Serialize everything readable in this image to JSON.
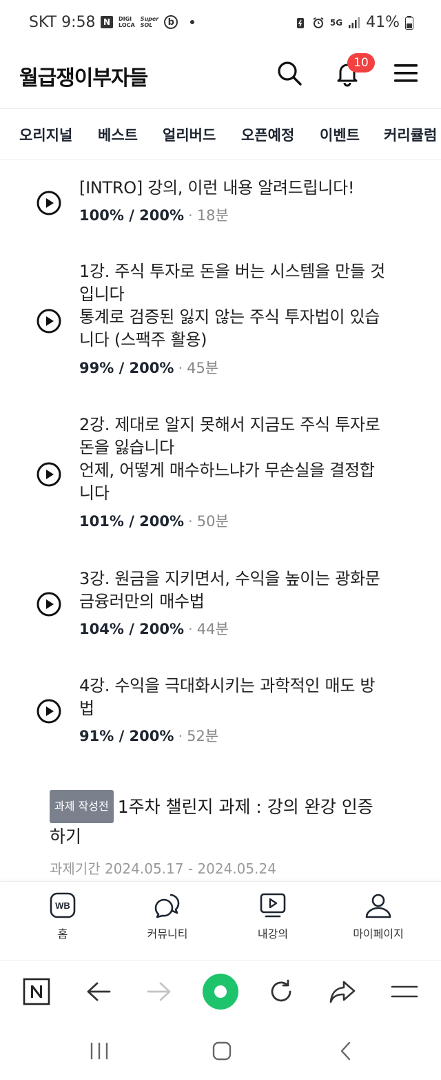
{
  "status_bar": {
    "carrier_time": "SKT 9:58",
    "badge_n": "N",
    "badge_digi": "DIGI",
    "badge_loca": "LOCA",
    "badge_super": "Super",
    "badge_sol": "SOL",
    "badge_b": "b",
    "network": "5G",
    "battery": "41%"
  },
  "header": {
    "logo": "월급쟁이부자들",
    "notification_count": "10",
    "icons": [
      "search-icon",
      "bell-icon",
      "menu-icon"
    ]
  },
  "tabs": [
    "오리지널",
    "베스트",
    "얼리버드",
    "오픈예정",
    "이벤트",
    "커리큘럼"
  ],
  "lessons": [
    {
      "title": "[INTRO] 강의, 이런 내용 알려드립니다!",
      "progress": "100% / 200%",
      "dot": "·",
      "duration": "18분"
    },
    {
      "title": "1강. 주식 투자로 돈을 버는 시스템을 만들 것\n입니다\n통계로 검증된 잃지 않는 주식 투자법이 있습\n니다 (스팩주 활용)",
      "progress": "99% / 200%",
      "dot": "·",
      "duration": "45분"
    },
    {
      "title": "2강. 제대로 알지 못해서 지금도 주식 투자로\n돈을 잃습니다\n언제, 어떻게 매수하느냐가 무손실을 결정합\n니다",
      "progress": "101% / 200%",
      "dot": "·",
      "duration": "50분"
    },
    {
      "title": "3강. 원금을 지키면서, 수익을 높이는 광화문\n금융러만의 매수법",
      "progress": "104% / 200%",
      "dot": "·",
      "duration": "44분"
    },
    {
      "title": "4강. 수익을 극대화시키는 과학적인 매도 방\n법",
      "progress": "91% / 200%",
      "dot": "·",
      "duration": "52분"
    }
  ],
  "assignment": {
    "tag": "과제 작성전",
    "title": "1주차 챌린지 과제 : 강의 완강 인증\n하기",
    "period": "과제기간 2024.05.17 - 2024.05.24"
  },
  "bottom_nav": [
    {
      "label": "홈",
      "icon": "wb-home-icon",
      "icon_text": "WB"
    },
    {
      "label": "커뮤니티",
      "icon": "chat-bubbles-icon"
    },
    {
      "label": "내강의",
      "icon": "play-video-icon"
    },
    {
      "label": "마이페이지",
      "icon": "user-icon"
    }
  ],
  "browser_toolbar": {
    "icons": [
      "naver-n-icon",
      "back-arrow-icon",
      "forward-arrow-icon",
      "green-dot-icon",
      "refresh-icon",
      "share-icon",
      "menu-lines-icon"
    ],
    "accent": "#1ec46b"
  },
  "colors": {
    "badge": "#f24141",
    "tag_bg": "#7a808c",
    "text_dark": "#1d2530"
  }
}
